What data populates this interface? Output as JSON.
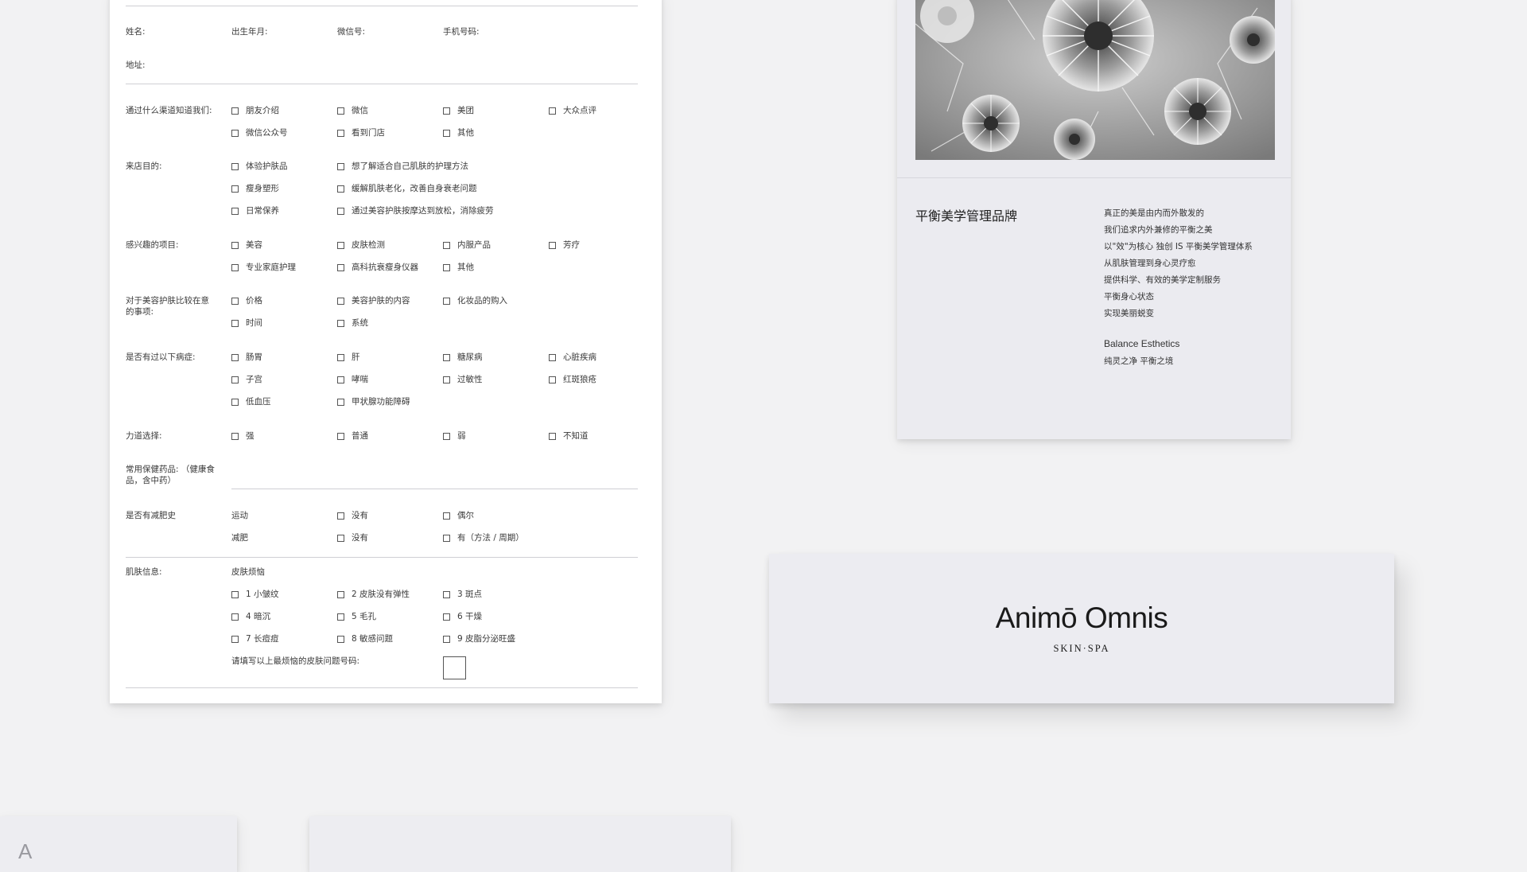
{
  "form": {
    "personal": {
      "name_label": "姓名:",
      "birth_label": "出生年月:",
      "wechat_label": "微信号:",
      "phone_label": "手机号码:",
      "address_label": "地址:"
    },
    "channel": {
      "label": "通过什么渠道知道我们:",
      "options": [
        "朋友介绍",
        "微信",
        "美团",
        "大众点评",
        "微信公众号",
        "看到门店",
        "其他"
      ]
    },
    "purpose": {
      "label": "来店目的:",
      "options": [
        "体验护肤品",
        "想了解适合自己肌肤的护理方法",
        "瘦身塑形",
        "缓解肌肤老化，改善自身衰老问题",
        "日常保养",
        "通过美容护肤按摩达到放松，消除疲劳"
      ]
    },
    "interests": {
      "label": "感兴趣的项目:",
      "options": [
        "美容",
        "皮肤检测",
        "内服产品",
        "芳疗",
        "专业家庭护理",
        "高科抗衰瘦身仪器",
        "其他"
      ]
    },
    "concerns": {
      "label": "对于美容护肤比较在意的事项:",
      "options": [
        "价格",
        "美容护肤的内容",
        "化妆品的购入",
        "时间",
        "系统"
      ]
    },
    "conditions": {
      "label": "是否有过以下病症:",
      "options": [
        "肠胃",
        "肝",
        "糖尿病",
        "心脏疾病",
        "子宫",
        "哮喘",
        "过敏性",
        "红斑狼疮",
        "低血压",
        "甲状腺功能障碍"
      ]
    },
    "pressure": {
      "label": "力道选择:",
      "options": [
        "强",
        "普通",
        "弱",
        "不知道"
      ]
    },
    "medicine": {
      "label": "常用保健药品: （健康食品，含中药）"
    },
    "diet_history": {
      "label": "是否有减肥史",
      "exercise_label": "运动",
      "exercise_options": [
        "没有",
        "偶尔"
      ],
      "diet_label": "减肥",
      "diet_options": [
        "没有",
        "有（方法 / 周期）"
      ]
    },
    "skin": {
      "label": "肌肤信息:",
      "subheading": "皮肤烦恼",
      "options": [
        "1  小皱纹",
        "2  皮肤没有弹性",
        "3  斑点",
        "4  暗沉",
        "5  毛孔",
        "6  干燥",
        "7  长痘痘",
        "8  敏感问题",
        "9  皮脂分泌旺盛"
      ],
      "prompt": "请填写以上最烦恼的皮肤问题号码:"
    }
  },
  "brand_card": {
    "title": "平衡美学管理品牌",
    "lines": [
      "真正的美是由内而外散发的",
      "我们追求内外兼修的平衡之美",
      "以\"效\"为核心 独创 IS 平衡美学管理体系",
      "从肌肤管理到身心灵疗愈",
      "提供科学、有效的美学定制服务",
      "平衡身心状态",
      "实现美丽蜕变"
    ],
    "english_name": "Balance Esthetics",
    "slogan": "纯灵之净  平衡之境"
  },
  "logo": {
    "name": "Animō Omnis",
    "subtitle": "SKIN·SPA"
  },
  "bottom_card": {
    "letter": "A"
  },
  "colors": {
    "background": "#f2f2f3",
    "paper": "#ffffff",
    "card": "#ebebf0",
    "ink": "#333333"
  }
}
